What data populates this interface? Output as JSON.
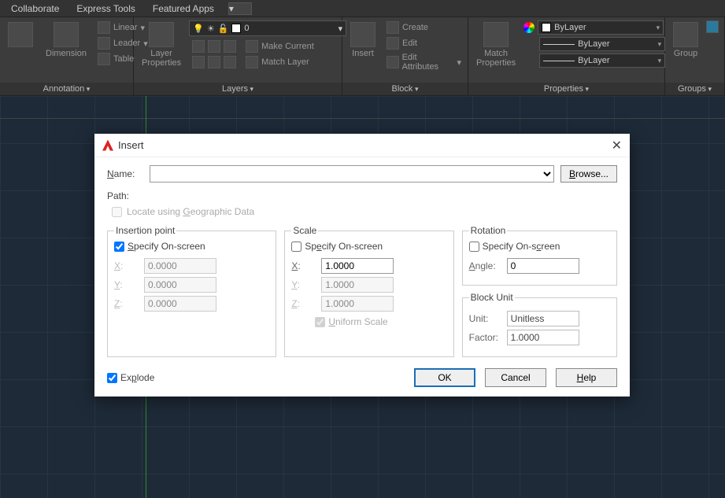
{
  "menubar": {
    "items": [
      "Collaborate",
      "Express Tools",
      "Featured Apps"
    ]
  },
  "ribbon": {
    "annotation": {
      "title": "Annotation",
      "dimension": "Dimension",
      "linear": "Linear",
      "leader": "Leader",
      "table": "Table"
    },
    "layers": {
      "title": "Layers",
      "properties": "Layer\nProperties",
      "makecurrent": "Make Current",
      "matchlayer": "Match Layer",
      "current": "0"
    },
    "block": {
      "title": "Block",
      "insert": "Insert",
      "create": "Create",
      "edit": "Edit",
      "editattr": "Edit Attributes"
    },
    "properties": {
      "title": "Properties",
      "match": "Match\nProperties",
      "bylayer1": "ByLayer",
      "bylayer2": "ByLayer",
      "bylayer3": "ByLayer"
    },
    "groups": {
      "title": "Groups",
      "group": "Group"
    }
  },
  "dialog": {
    "title": "Insert",
    "nameLabel": "Name:",
    "browse": "Browse...",
    "pathLabel": "Path:",
    "locateGeo": "Locate using Geographic Data",
    "insertion": {
      "legend": "Insertion point",
      "specify": "Specify On-screen",
      "x": "0.0000",
      "y": "0.0000",
      "z": "0.0000"
    },
    "scale": {
      "legend": "Scale",
      "specify": "Specify On-screen",
      "x": "1.0000",
      "y": "1.0000",
      "z": "1.0000",
      "uniform": "Uniform Scale"
    },
    "rotation": {
      "legend": "Rotation",
      "specify": "Specify On-screen",
      "angleLabel": "Angle:",
      "angle": "0"
    },
    "blockunit": {
      "legend": "Block Unit",
      "unitLabel": "Unit:",
      "unit": "Unitless",
      "factorLabel": "Factor:",
      "factor": "1.0000"
    },
    "explode": "Explode",
    "ok": "OK",
    "cancel": "Cancel",
    "help": "Help"
  }
}
